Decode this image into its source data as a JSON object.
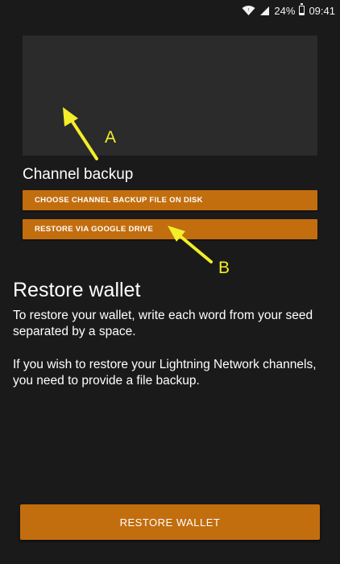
{
  "status_bar": {
    "battery": "24%",
    "time": "09:41"
  },
  "channel_backup": {
    "title": "Channel backup",
    "choose_file_button": "CHOOSE CHANNEL BACKUP FILE ON DISK",
    "google_drive_button": "RESTORE VIA GOOGLE DRIVE"
  },
  "restore": {
    "title": "Restore wallet",
    "paragraph1": "To restore your wallet, write each word from your seed separated by a space.",
    "paragraph2": "If you wish to restore your Lightning Network channels, you need to provide a file backup.",
    "button": "RESTORE WALLET"
  },
  "annotations": {
    "a": "A",
    "b": "B"
  },
  "colors": {
    "accent": "#c26e0f",
    "annotation": "#f2ee2a",
    "background": "#1b1a1b"
  }
}
